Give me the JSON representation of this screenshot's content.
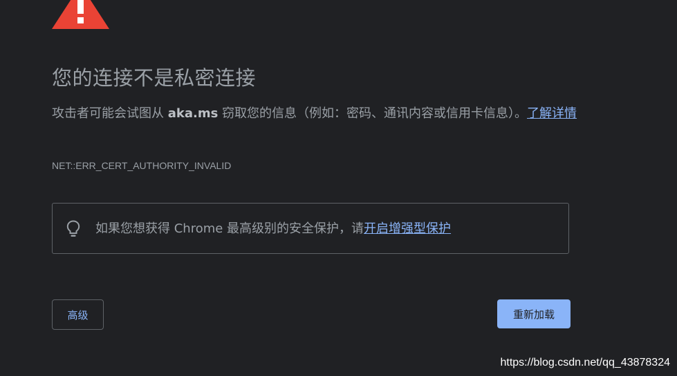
{
  "page": {
    "icon": "warning-triangle-icon",
    "title": "您的连接不是私密连接",
    "description_before": "攻击者可能会试图从 ",
    "domain": "aka.ms",
    "description_after": " 窃取您的信息（例如：密码、通讯内容或信用卡信息）。",
    "learn_more": "了解详情",
    "error_code": "NET::ERR_CERT_AUTHORITY_INVALID"
  },
  "banner": {
    "icon": "lightbulb-icon",
    "text": "如果您想获得 Chrome 最高级别的安全保护，请",
    "link": "开启增强型保护"
  },
  "buttons": {
    "advanced": "高级",
    "reload": "重新加载"
  },
  "watermark": "https://blog.csdn.net/qq_43878324",
  "colors": {
    "background": "#202124",
    "text": "#9aa0a6",
    "link": "#8ab4f8",
    "warning": "#ea4335",
    "border": "#5f6368"
  }
}
